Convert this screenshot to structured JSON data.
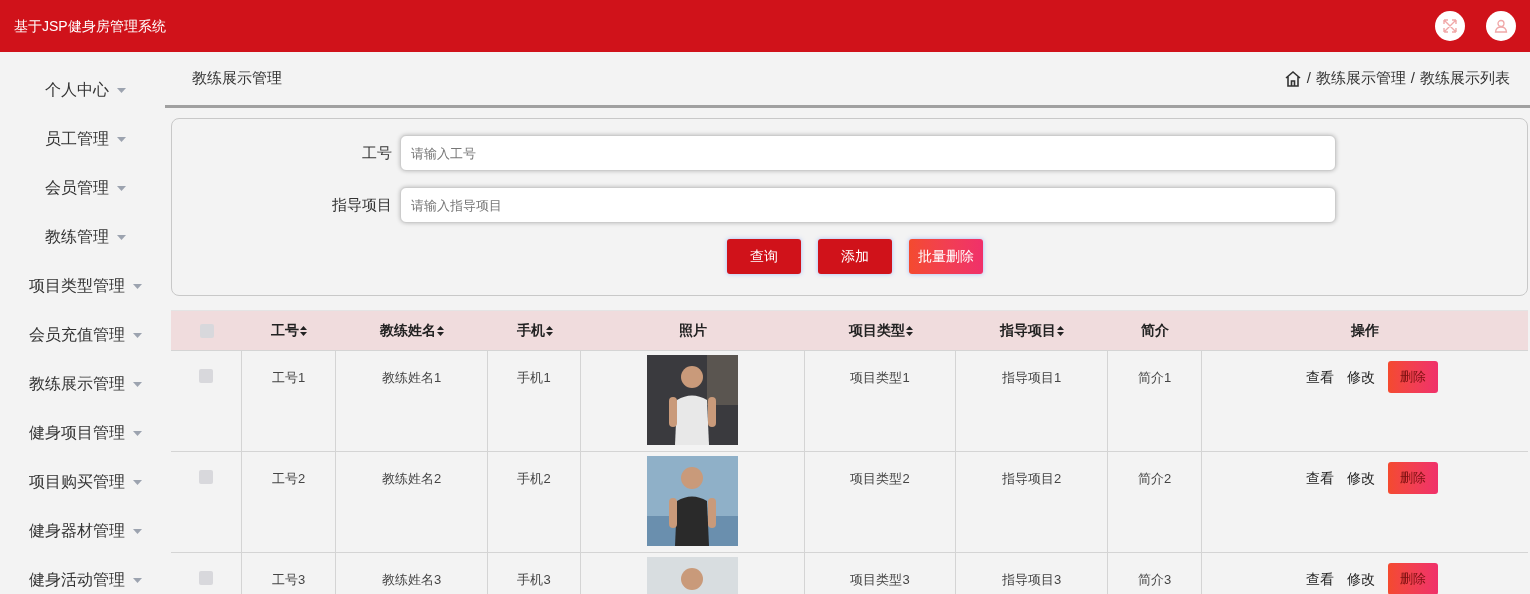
{
  "header": {
    "title": "基于JSP健身房管理系统"
  },
  "sidebar": {
    "items": [
      {
        "label": "个人中心"
      },
      {
        "label": "员工管理"
      },
      {
        "label": "会员管理"
      },
      {
        "label": "教练管理"
      },
      {
        "label": "项目类型管理"
      },
      {
        "label": "会员充值管理"
      },
      {
        "label": "教练展示管理"
      },
      {
        "label": "健身项目管理"
      },
      {
        "label": "项目购买管理"
      },
      {
        "label": "健身器材管理"
      },
      {
        "label": "健身活动管理"
      }
    ]
  },
  "page": {
    "title": "教练展示管理",
    "breadcrumb": [
      {
        "separator": "/",
        "label": "教练展示管理"
      },
      {
        "separator": "/",
        "label": "教练展示列表"
      }
    ]
  },
  "search": {
    "fields": [
      {
        "label": "工号",
        "placeholder": "请输入工号"
      },
      {
        "label": "指导项目",
        "placeholder": "请输入指导项目"
      }
    ],
    "buttons": [
      {
        "label": "查询",
        "kind": "primary"
      },
      {
        "label": "添加",
        "kind": "primary"
      },
      {
        "label": "批量删除",
        "kind": "danger"
      }
    ]
  },
  "table": {
    "header_checked": false,
    "columns": [
      {
        "label": "工号",
        "sortable": true
      },
      {
        "label": "教练姓名",
        "sortable": true
      },
      {
        "label": "手机",
        "sortable": true
      },
      {
        "label": "照片",
        "sortable": false
      },
      {
        "label": "项目类型",
        "sortable": true
      },
      {
        "label": "指导项目",
        "sortable": true
      },
      {
        "label": "简介",
        "sortable": false
      },
      {
        "label": "操作",
        "sortable": false
      }
    ],
    "rows": [
      {
        "checked": false,
        "cells": [
          "工号1",
          "教练姓名1",
          "手机1",
          {
            "kind": "picture"
          },
          "项目类型1",
          "指导项目1",
          "简介1"
        ],
        "actions": [
          {
            "label": "查看",
            "kind": "link"
          },
          {
            "label": "修改",
            "kind": "link"
          },
          {
            "label": "删除",
            "kind": "danger"
          }
        ]
      },
      {
        "checked": false,
        "cells": [
          "工号2",
          "教练姓名2",
          "手机2",
          {
            "kind": "picture"
          },
          "项目类型2",
          "指导项目2",
          "简介2"
        ],
        "actions": [
          {
            "label": "查看",
            "kind": "link"
          },
          {
            "label": "修改",
            "kind": "link"
          },
          {
            "label": "删除",
            "kind": "danger"
          }
        ]
      },
      {
        "checked": false,
        "cells": [
          "工号3",
          "教练姓名3",
          "手机3",
          {
            "kind": "picture"
          },
          "项目类型3",
          "指导项目3",
          "简介3"
        ],
        "actions": [
          {
            "label": "查看",
            "kind": "link"
          },
          {
            "label": "修改",
            "kind": "link"
          },
          {
            "label": "删除",
            "kind": "danger"
          }
        ]
      }
    ]
  }
}
